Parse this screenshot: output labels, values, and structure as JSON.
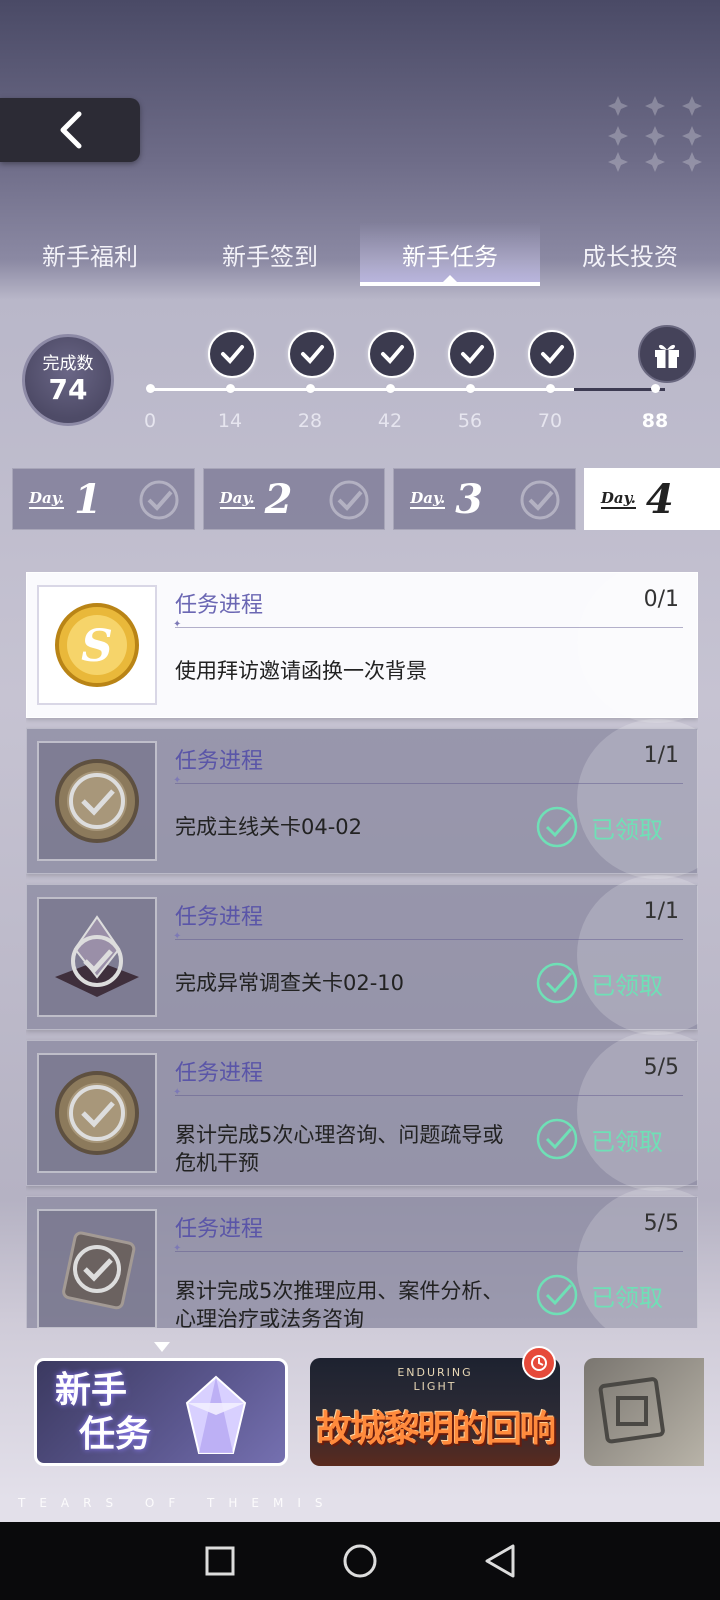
{
  "tabs": [
    {
      "label": "新手福利",
      "active": false
    },
    {
      "label": "新手签到",
      "active": false
    },
    {
      "label": "新手任务",
      "active": true
    },
    {
      "label": "成长投资",
      "active": false
    }
  ],
  "progress": {
    "label": "完成数",
    "value": "74",
    "milestones": [
      "0",
      "14",
      "28",
      "42",
      "56",
      "70",
      "88"
    ],
    "current": 74,
    "max": 88
  },
  "days": [
    {
      "word": "Day.",
      "num": "1",
      "completed": true
    },
    {
      "word": "Day.",
      "num": "2",
      "completed": true
    },
    {
      "word": "Day.",
      "num": "3",
      "completed": true
    },
    {
      "word": "Day.",
      "num": "4",
      "active": true
    }
  ],
  "tasks": [
    {
      "header": "任务进程",
      "count": "0/1",
      "desc": "使用拜访邀请函换一次背景",
      "icon": "coin-icon",
      "status": ""
    },
    {
      "header": "任务进程",
      "count": "1/1",
      "desc": "完成主线关卡04-02",
      "icon": "coin-icon",
      "status": "已领取"
    },
    {
      "header": "任务进程",
      "count": "1/1",
      "desc": "完成异常调查关卡02-10",
      "icon": "crystal-icon",
      "status": "已领取"
    },
    {
      "header": "任务进程",
      "count": "5/5",
      "desc": "累计完成5次心理咨询、问题疏导或危机干预",
      "icon": "coin-icon",
      "status": "已领取"
    },
    {
      "header": "任务进程",
      "count": "5/5",
      "desc": "累计完成5次推理应用、案件分析、心理治疗或法务咨询",
      "icon": "badge-icon",
      "status": "已领取"
    }
  ],
  "banners": {
    "first_line1": "新手",
    "first_line2": "任务",
    "second_sub": "ENDURING",
    "second_sub2": "LIGHT",
    "second_title": "故城黎明的回响"
  },
  "brand": "TEARS OF THEMIS",
  "colors": {
    "accent": "#5a55a8",
    "claimed": "#6fe0b6"
  }
}
